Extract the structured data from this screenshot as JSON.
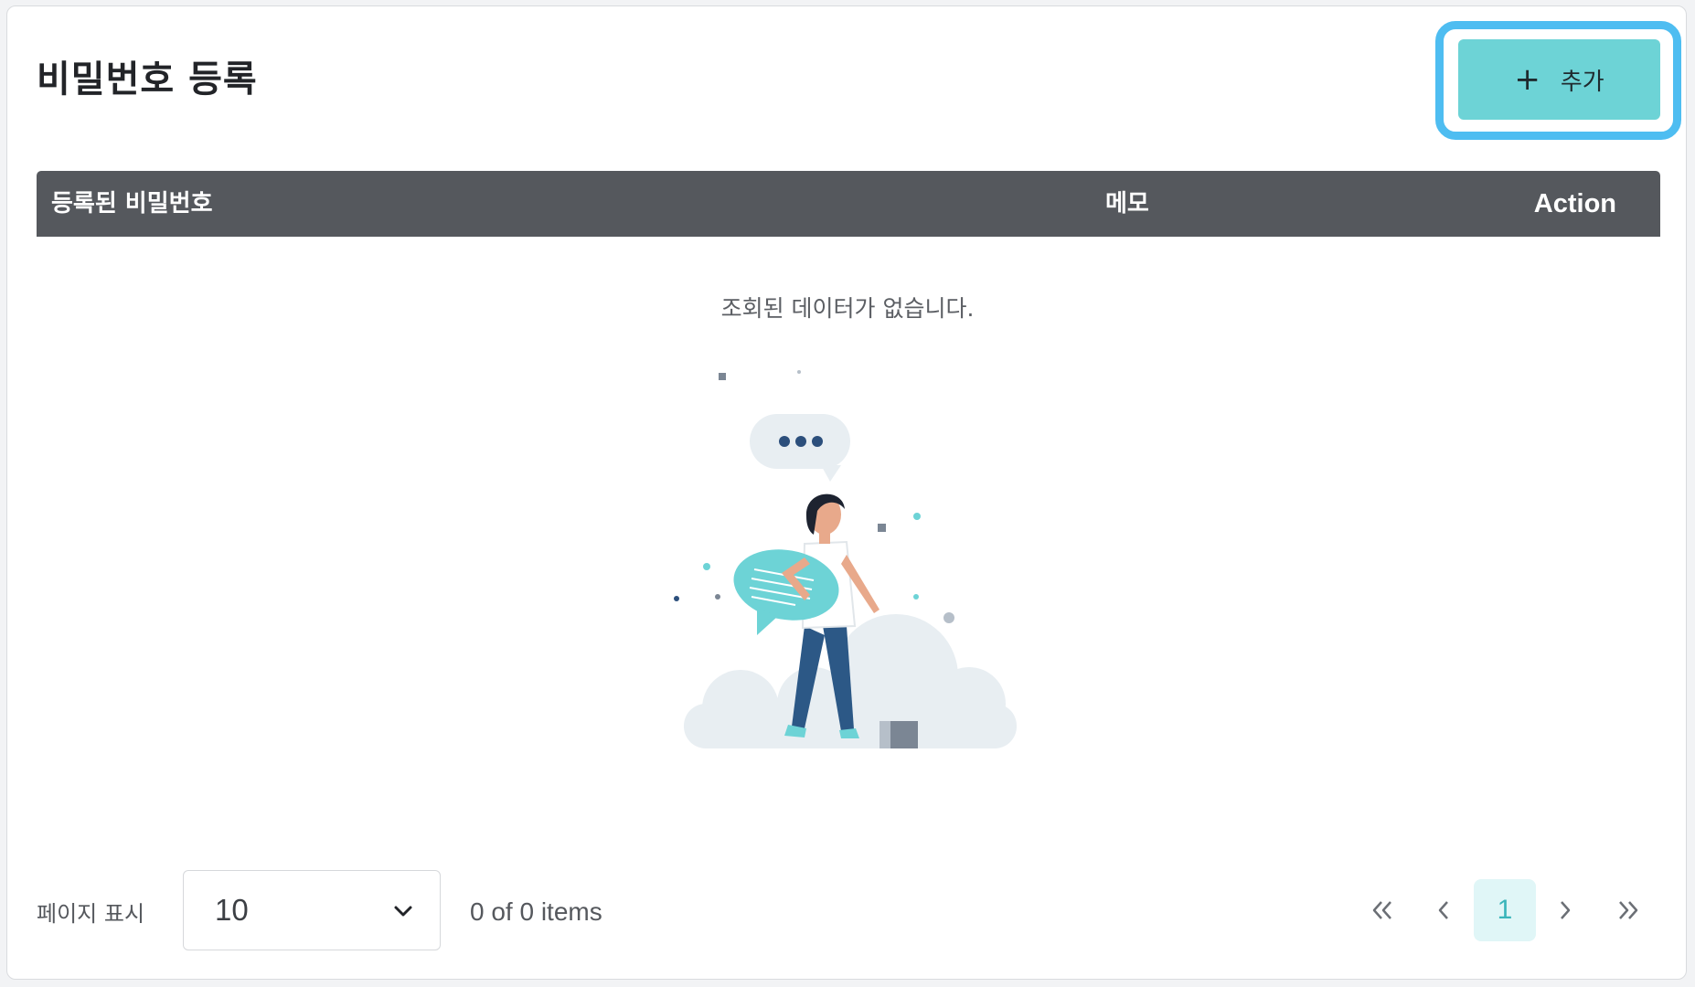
{
  "header": {
    "title": "비밀번호 등록",
    "add_button": {
      "icon": "plus-icon",
      "label": "추가"
    }
  },
  "table": {
    "columns": [
      "등록된 비밀번호",
      "메모",
      "Action"
    ],
    "rows": [],
    "empty_message": "조회된 데이터가 없습니다."
  },
  "footer": {
    "page_size_label": "페이지 표시",
    "page_size_value": "10",
    "items_count": "0 of 0 items",
    "pagination": {
      "first_icon": "double-chevron-left-icon",
      "prev_icon": "chevron-left-icon",
      "current_page": "1",
      "next_icon": "chevron-right-icon",
      "last_icon": "double-chevron-right-icon"
    }
  },
  "colors": {
    "accent": "#6dd3d6",
    "focus_ring": "#4ebdf1",
    "table_header": "#55585d",
    "current_page_bg": "#e0f6f7",
    "current_page_text": "#3ab5ba"
  }
}
